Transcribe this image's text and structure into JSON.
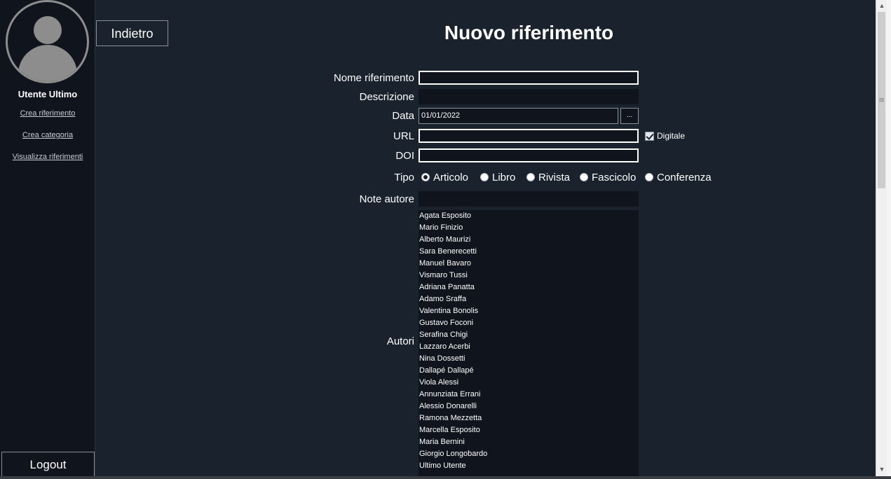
{
  "sidebar": {
    "username": "Utente Ultimo",
    "links": [
      "Crea riferimento",
      "Crea categoria",
      "Visualizza riferimenti"
    ],
    "logout_label": "Logout"
  },
  "main": {
    "back_label": "Indietro",
    "title": "Nuovo riferimento"
  },
  "form": {
    "name_label": "Nome riferimento",
    "name_value": "",
    "description_label": "Descrizione",
    "description_value": "",
    "date_label": "Data",
    "date_value": "01/01/2022",
    "date_button": "...",
    "url_label": "URL",
    "url_value": "",
    "digital_label": "Digitale",
    "digital_checked": true,
    "doi_label": "DOI",
    "doi_value": "",
    "type_label": "Tipo",
    "types": [
      "Articolo",
      "Libro",
      "Rivista",
      "Fascicolo",
      "Conferenza"
    ],
    "selected_type": "Articolo",
    "author_notes_label": "Note autore",
    "author_notes_value": "",
    "authors_label": "Autori",
    "authors": [
      "Agata Esposito",
      "Mario Finizio",
      "Alberto Maurizi",
      "Sara Benerecetti",
      "Manuel Bavaro",
      "Vismaro Tussi",
      "Adriana  Panatta",
      "Adamo Sraffa",
      "Valentina  Bonolis",
      "Gustavo  Foconi",
      "Serafina Chigi",
      "Lazzaro Acerbi",
      "Nina Dossetti",
      "Dallapé Dallapé",
      "Viola Alessi",
      "Annunziata Errani",
      "Alessio Donarelli",
      "Ramona Mezzetta",
      "Marcella Esposito",
      "Maria Bernini",
      "Giorgio Longobardo",
      "Ultimo Utente"
    ]
  },
  "colors": {
    "sidebar_bg": "#0f141d",
    "main_bg": "#1a222d",
    "text": "#ffffff",
    "avatar": "#8d8d8d"
  }
}
